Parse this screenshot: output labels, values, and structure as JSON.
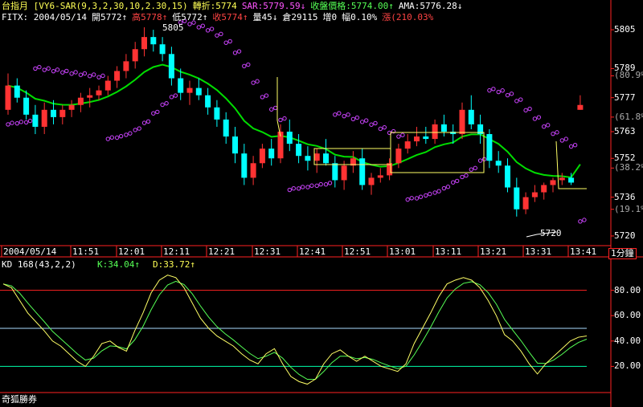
{
  "header": {
    "line1": [
      {
        "text": "台指月 [VY6-SAR(9,3,2,30,10,2.30,15)",
        "color": "#ffff55"
      },
      {
        "text": "轉折:5774",
        "color": "#ffff55"
      },
      {
        "text": "SAR:5779.59↓",
        "color": "#ff55ff"
      },
      {
        "text": "收盤價格:5774.00↑",
        "color": "#55ff55"
      },
      {
        "text": "AMA:5776.28↓",
        "color": "#ffffff"
      }
    ],
    "line2": [
      {
        "text": "FITX: 2004/05/14",
        "color": "#ffffff"
      },
      {
        "text": "開5772↑",
        "color": "#ffffff"
      },
      {
        "text": "高5778↑",
        "color": "#ff4444"
      },
      {
        "text": "低5772↑",
        "color": "#ffffff"
      },
      {
        "text": "收5774↑",
        "color": "#ff4444"
      },
      {
        "text": "量45↓",
        "color": "#ffffff"
      },
      {
        "text": "倉29115",
        "color": "#ffffff"
      },
      {
        "text": "增0",
        "color": "#ffffff"
      },
      {
        "text": "幅0.10%",
        "color": "#ffffff"
      },
      {
        "text": "漲(210.03%",
        "color": "#ff4444"
      }
    ]
  },
  "price_axis": {
    "labels": [
      {
        "value": 5805,
        "text": "5805"
      },
      {
        "value": 5789,
        "text": "5789"
      },
      {
        "value": 5786,
        "text": "(80.9%)"
      },
      {
        "value": 5777,
        "text": "5777"
      },
      {
        "value": 5769,
        "text": "(61.8%)"
      },
      {
        "value": 5763,
        "text": "5763"
      },
      {
        "value": 5752,
        "text": "5752"
      },
      {
        "value": 5748,
        "text": "(38.2%)"
      },
      {
        "value": 5736,
        "text": "5736"
      },
      {
        "value": 5731,
        "text": "(19.1%)"
      },
      {
        "value": 5720,
        "text": "5720"
      }
    ]
  },
  "annotations": {
    "high_label": "5805",
    "low_label": "5720"
  },
  "time_axis": {
    "labels": [
      "2004/05/14",
      "11:51",
      "12:01",
      "12:11",
      "12:21",
      "12:31",
      "12:41",
      "12:51",
      "13:01",
      "13:11",
      "13:21",
      "13:31",
      "13:41"
    ],
    "interval_button": "1分鐘"
  },
  "indicator": {
    "title": "KD 168(43,2,2)",
    "k_text": "K:34.04↑",
    "d_text": "D:33.72↑",
    "levels": [
      80,
      50,
      20
    ],
    "axis_labels": [
      "80.00",
      "60.00",
      "40.00",
      "20.00"
    ]
  },
  "footer": {
    "brand": "奇狐勝券"
  },
  "colors": {
    "up": "#ff3333",
    "down": "#00ffff",
    "sar": "#cc44ff",
    "ama_green": "#00dd00",
    "ama_red": "#ff2222",
    "zigzag": "#ffff66",
    "k_line": "#ffff66",
    "d_line": "#55ff55",
    "level80": "#ff2222",
    "level50": "#aaddff",
    "level20": "#00ffaa",
    "frame": "#ff2222"
  },
  "chart_data": {
    "type": "candlestick",
    "ylim": [
      5718,
      5808
    ],
    "candles": [
      [
        5772,
        5787,
        5770,
        5782
      ],
      [
        5782,
        5785,
        5775,
        5777
      ],
      [
        5777,
        5780,
        5768,
        5770
      ],
      [
        5770,
        5774,
        5762,
        5765
      ],
      [
        5765,
        5775,
        5762,
        5772
      ],
      [
        5772,
        5776,
        5766,
        5769
      ],
      [
        5769,
        5774,
        5766,
        5772
      ],
      [
        5772,
        5776,
        5769,
        5774
      ],
      [
        5774,
        5779,
        5771,
        5777
      ],
      [
        5777,
        5781,
        5773,
        5778
      ],
      [
        5778,
        5782,
        5776,
        5780
      ],
      [
        5780,
        5786,
        5778,
        5784
      ],
      [
        5784,
        5790,
        5781,
        5788
      ],
      [
        5788,
        5795,
        5785,
        5792
      ],
      [
        5792,
        5800,
        5789,
        5797
      ],
      [
        5797,
        5806,
        5794,
        5802
      ],
      [
        5802,
        5805,
        5796,
        5799
      ],
      [
        5799,
        5802,
        5792,
        5795
      ],
      [
        5795,
        5798,
        5782,
        5785
      ],
      [
        5785,
        5789,
        5776,
        5779
      ],
      [
        5779,
        5784,
        5774,
        5781
      ],
      [
        5781,
        5785,
        5776,
        5778
      ],
      [
        5778,
        5781,
        5770,
        5773
      ],
      [
        5773,
        5776,
        5765,
        5768
      ],
      [
        5768,
        5771,
        5758,
        5761
      ],
      [
        5761,
        5765,
        5750,
        5754
      ],
      [
        5754,
        5758,
        5741,
        5744
      ],
      [
        5744,
        5753,
        5741,
        5750
      ],
      [
        5750,
        5758,
        5748,
        5756
      ],
      [
        5756,
        5760,
        5749,
        5752
      ],
      [
        5752,
        5766,
        5750,
        5763
      ],
      [
        5763,
        5768,
        5755,
        5758
      ],
      [
        5758,
        5762,
        5750,
        5753
      ],
      [
        5753,
        5757,
        5747,
        5751
      ],
      [
        5751,
        5756,
        5746,
        5754
      ],
      [
        5754,
        5760,
        5749,
        5750
      ],
      [
        5750,
        5753,
        5740,
        5743
      ],
      [
        5743,
        5751,
        5739,
        5749
      ],
      [
        5749,
        5755,
        5746,
        5752
      ],
      [
        5752,
        5756,
        5739,
        5741
      ],
      [
        5741,
        5746,
        5737,
        5744
      ],
      [
        5744,
        5748,
        5742,
        5745
      ],
      [
        5745,
        5752,
        5743,
        5750
      ],
      [
        5750,
        5758,
        5748,
        5756
      ],
      [
        5756,
        5762,
        5754,
        5759
      ],
      [
        5759,
        5765,
        5757,
        5761
      ],
      [
        5761,
        5765,
        5758,
        5760
      ],
      [
        5760,
        5768,
        5758,
        5766
      ],
      [
        5766,
        5770,
        5761,
        5763
      ],
      [
        5763,
        5766,
        5758,
        5762
      ],
      [
        5762,
        5775,
        5760,
        5772
      ],
      [
        5772,
        5778,
        5764,
        5766
      ],
      [
        5766,
        5770,
        5758,
        5762
      ],
      [
        5762,
        5764,
        5748,
        5751
      ],
      [
        5751,
        5755,
        5746,
        5749
      ],
      [
        5749,
        5752,
        5738,
        5740
      ],
      [
        5740,
        5744,
        5728,
        5731
      ],
      [
        5731,
        5738,
        5729,
        5736
      ],
      [
        5736,
        5741,
        5734,
        5738
      ],
      [
        5738,
        5742,
        5735,
        5741
      ],
      [
        5741,
        5744,
        5738,
        5743
      ],
      [
        5743,
        5746,
        5741,
        5744
      ],
      [
        5744,
        5746,
        5741,
        5742
      ],
      [
        5772,
        5778,
        5772,
        5774
      ]
    ],
    "k_values": [
      85,
      82,
      72,
      62,
      55,
      48,
      40,
      36,
      30,
      24,
      20,
      28,
      38,
      40,
      35,
      32,
      48,
      62,
      78,
      88,
      92,
      90,
      82,
      70,
      58,
      50,
      44,
      40,
      36,
      30,
      25,
      22,
      30,
      34,
      22,
      12,
      8,
      6,
      10,
      22,
      30,
      33,
      28,
      24,
      28,
      24,
      20,
      18,
      16,
      22,
      38,
      50,
      62,
      75,
      85,
      88,
      90,
      88,
      82,
      72,
      60,
      45,
      40,
      32,
      22,
      14,
      22,
      28,
      34,
      40,
      43,
      44
    ]
  }
}
